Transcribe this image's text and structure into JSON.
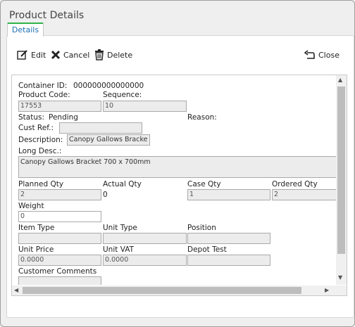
{
  "window": {
    "title": "Product Details"
  },
  "tabs": [
    {
      "label": "Details"
    }
  ],
  "toolbar": {
    "edit_label": "Edit",
    "cancel_label": "Cancel",
    "delete_label": "Delete",
    "close_label": "Close"
  },
  "form": {
    "container_id_label": "Container ID:",
    "container_id_value": "000000000000000",
    "product_code_label": "Product Code:",
    "product_code_value": "17553",
    "sequence_label": "Sequence:",
    "sequence_value": "10",
    "status_label": "Status:",
    "status_value": "Pending",
    "reason_label": "Reason:",
    "cust_ref_label": "Cust Ref.:",
    "cust_ref_value": "",
    "description_label": "Description:",
    "description_value": "Canopy Gallows Bracke",
    "long_desc_label": "Long Desc.:",
    "long_desc_value": "Canopy Gallows Bracket 700 x 700mm",
    "planned_qty_label": "Planned Qty",
    "planned_qty_value": "2",
    "actual_qty_label": "Actual Qty",
    "actual_qty_value": "0",
    "case_qty_label": "Case Qty",
    "case_qty_value": "1",
    "ordered_qty_label": "Ordered Qty",
    "ordered_qty_value": "2",
    "weight_label": "Weight",
    "weight_value": "0",
    "item_type_label": "Item Type",
    "item_type_value": "",
    "unit_type_label": "Unit Type",
    "unit_type_value": "",
    "position_label": "Position",
    "position_value": "",
    "unit_price_label": "Unit Price",
    "unit_price_value": "0.0000",
    "unit_vat_label": "Unit VAT",
    "unit_vat_value": "0.0000",
    "depot_test_label": "Depot Test",
    "depot_test_value": "",
    "customer_comments_label": "Customer Comments"
  }
}
